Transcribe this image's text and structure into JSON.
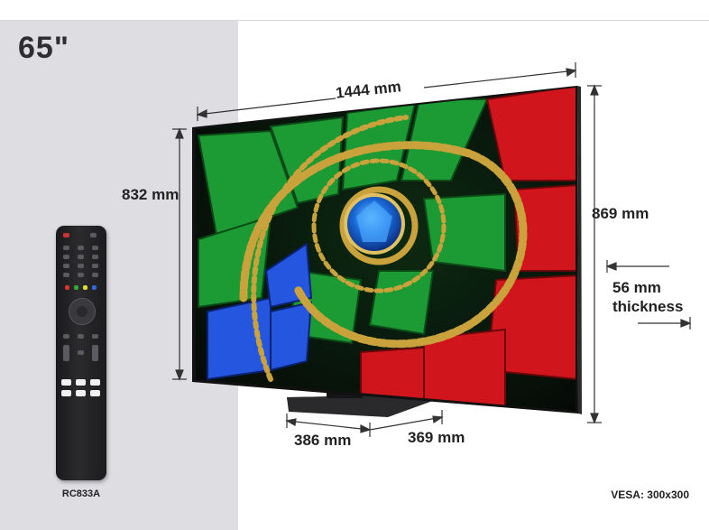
{
  "screen_size": "65\"",
  "dimensions": {
    "width": "1444 mm",
    "screen_height": "832 mm",
    "total_height": "869 mm",
    "stand_depth": "386 mm",
    "stand_width": "369 mm",
    "thickness_value": "56 mm",
    "thickness_word": "thickness"
  },
  "remote_model": "RC833A",
  "vesa": "VESA: 300x300",
  "colors": {
    "panel": "#dddde2",
    "green": "#1a8a2e",
    "blue": "#1f4fd6",
    "red": "#c8141a",
    "gold": "#c9a23a"
  }
}
